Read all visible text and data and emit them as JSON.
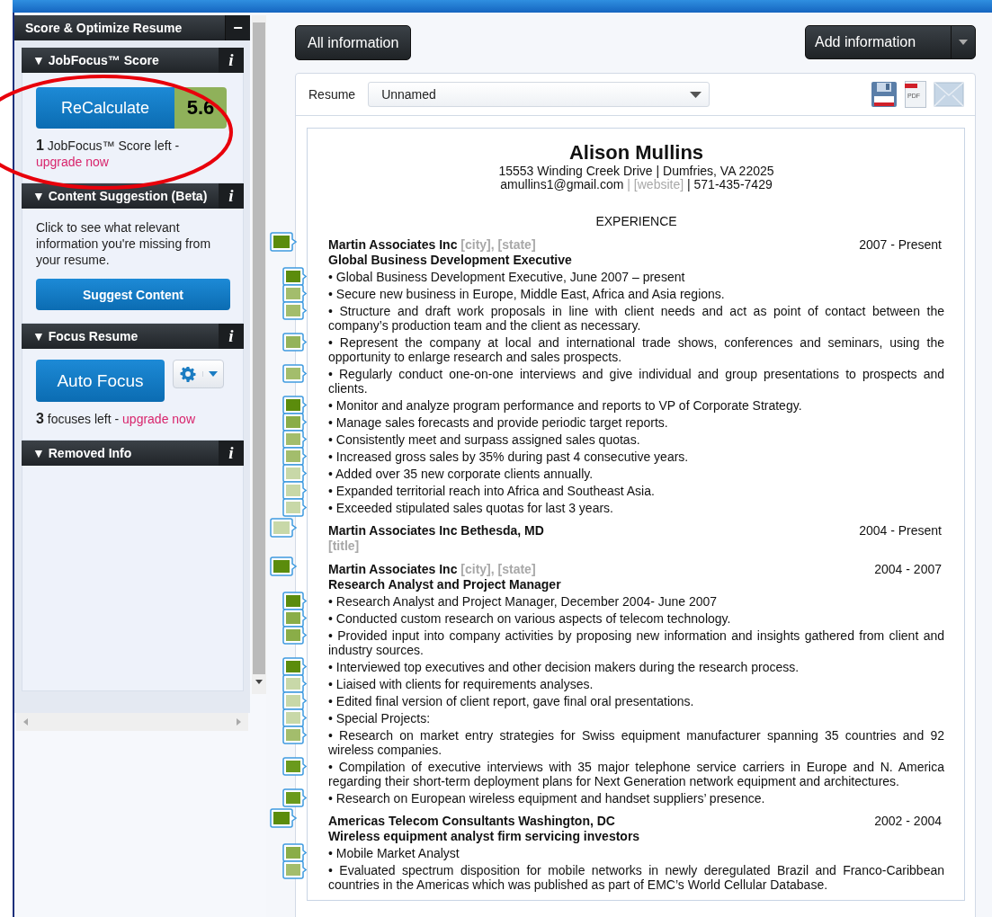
{
  "sidebar": {
    "title": "Score & Optimize Resume",
    "collapse": "−",
    "sections": [
      {
        "kind": "score",
        "title": "▼ JobFocus™ Score",
        "info": "i",
        "button": "ReCalculate",
        "score": "5.6",
        "note": "**1** JobFocus™ Score left -",
        "link": "upgrade now"
      },
      {
        "kind": "suggest",
        "title": "▼ Content Suggestion (Beta)",
        "info": "i",
        "text": "Click to see what relevant information you're missing from your resume.",
        "button": "Suggest Content"
      },
      {
        "kind": "focus",
        "title": "▼ Focus Resume",
        "info": "i",
        "button": "Auto Focus",
        "note": "**3** focuses left -",
        "link": "upgrade now"
      },
      {
        "kind": "removed",
        "title": "▼ Removed Info",
        "info": "i"
      }
    ]
  },
  "toolbar": {
    "left_button": "All information",
    "right_button": "Add information"
  },
  "resume_bar": {
    "label": "Resume",
    "select": "Unnamed",
    "pdf_label": "PDF"
  },
  "resume": {
    "name": "Alison Mullins",
    "address": "15553 Winding Creek Drive | Dumfries, VA 22025",
    "contact": [
      {
        "text": "amullins1@gmail.com",
        "placeholder": false
      },
      {
        "text": " | [website]",
        "placeholder": true
      },
      {
        "text": " | 571-435-7429",
        "placeholder": false
      }
    ],
    "section": "EXPERIENCE",
    "jobs": [
      {
        "company": [
          {
            "text": "Martin Associates Inc",
            "placeholder": false
          },
          {
            "text": " [city], [state]",
            "placeholder": true
          }
        ],
        "dates": "2007 - Present",
        "title": {
          "text": "Global Business Development Executive",
          "placeholder": false
        },
        "color": "#5b8c0c",
        "bullets": [
          {
            "text": "• Global Business Development Executive, June 2007 – present",
            "color": "#5b8c0c"
          },
          {
            "text": "• Secure new business in Europe, Middle East, Africa and Asia regions.",
            "color": "#a3bd6c"
          },
          {
            "text": "• Structure and draft work proposals in line with client needs and act as point of contact between the company’s production team and the client as necessary.",
            "color": "#a3bd6c"
          },
          {
            "text": "• Represent the company at local and international trade shows, conferences and seminars, using the opportunity to enlarge research and sales prospects.",
            "color": "#94b35a"
          },
          {
            "text": "• Regularly conduct one-on-one interviews and give individual and group presentations to prospects and clients.",
            "color": "#a3bd6c"
          },
          {
            "text": "• Monitor and analyze program performance and reports to VP of Corporate Strategy.",
            "color": "#5b8c0c"
          },
          {
            "text": "• Manage sales forecasts and provide periodic target reports.",
            "color": "#8aad48"
          },
          {
            "text": "• Consistently meet and surpass assigned sales quotas.",
            "color": "#a3bd6c"
          },
          {
            "text": "• Increased gross sales by 35% during past 4 consecutive years.",
            "color": "#a3bd6c"
          },
          {
            "text": "• Added over 35 new corporate clients annually.",
            "color": "#c8d8a8"
          },
          {
            "text": "• Expanded territorial reach into Africa and Southeast Asia.",
            "color": "#c8d8a8"
          },
          {
            "text": "• Exceeded stipulated sales quotas for last 3 years.",
            "color": "#c8d8a8"
          }
        ]
      },
      {
        "company": [
          {
            "text": "Martin Associates Inc Bethesda, MD",
            "placeholder": false
          }
        ],
        "dates": "2004 - Present",
        "title": {
          "text": "[title]",
          "placeholder": true
        },
        "color": "#c8d8a8"
      },
      {
        "company": [
          {
            "text": "Martin Associates Inc",
            "placeholder": false
          },
          {
            "text": " [city], [state]",
            "placeholder": true
          }
        ],
        "dates": "2004 - 2007",
        "title": {
          "text": "Research Analyst and Project Manager",
          "placeholder": false
        },
        "color": "#5b8c0c",
        "bullets": [
          {
            "text": "• Research Analyst and Project Manager, December 2004- June 2007",
            "color": "#5b8c0c"
          },
          {
            "text": "• Conducted custom research on various aspects of telecom technology.",
            "color": "#8aad48"
          },
          {
            "text": "• Provided input into company activities by proposing new information and insights gathered from client and industry sources.",
            "color": "#8aad48"
          },
          {
            "text": "• Interviewed top executives and other decision makers during the research process.",
            "color": "#5b8c0c"
          },
          {
            "text": "• Liaised with clients for requirements analyses.",
            "color": "#c8d8a8"
          },
          {
            "text": "• Edited final version of client report, gave final oral presentations.",
            "color": "#c8d8a8"
          },
          {
            "text": "• Special Projects:",
            "color": "#c8d8a8"
          },
          {
            "text": "• Research on market entry strategies for Swiss equipment manufacturer spanning 35 countries and 92 wireless companies.",
            "color": "#a3bd6c"
          },
          {
            "text": "• Compilation of executive interviews with 35 major telephone service carriers in Europe and N. America regarding their short-term deployment plans for Next Generation network equipment and architectures.",
            "color": "#6a9a1c"
          },
          {
            "text": "• Research on European wireless equipment and handset suppliers’ presence.",
            "color": "#6a9a1c"
          }
        ]
      },
      {
        "company": [
          {
            "text": "Americas Telecom Consultants Washington, DC",
            "placeholder": false
          }
        ],
        "dates": "2002 - 2004",
        "title": {
          "text": "Wireless equipment analyst firm servicing investors",
          "placeholder": false
        },
        "color": "#5b8c0c",
        "bullets": [
          {
            "text": "• Mobile Market Analyst",
            "color": "#8aad48"
          },
          {
            "text": "• Evaluated spectrum disposition for mobile networks in newly deregulated Brazil and Franco-Caribbean countries in the Americas which was published as part of EMC’s World Cellular Database.",
            "color": "#a3bd6c"
          }
        ]
      }
    ]
  }
}
